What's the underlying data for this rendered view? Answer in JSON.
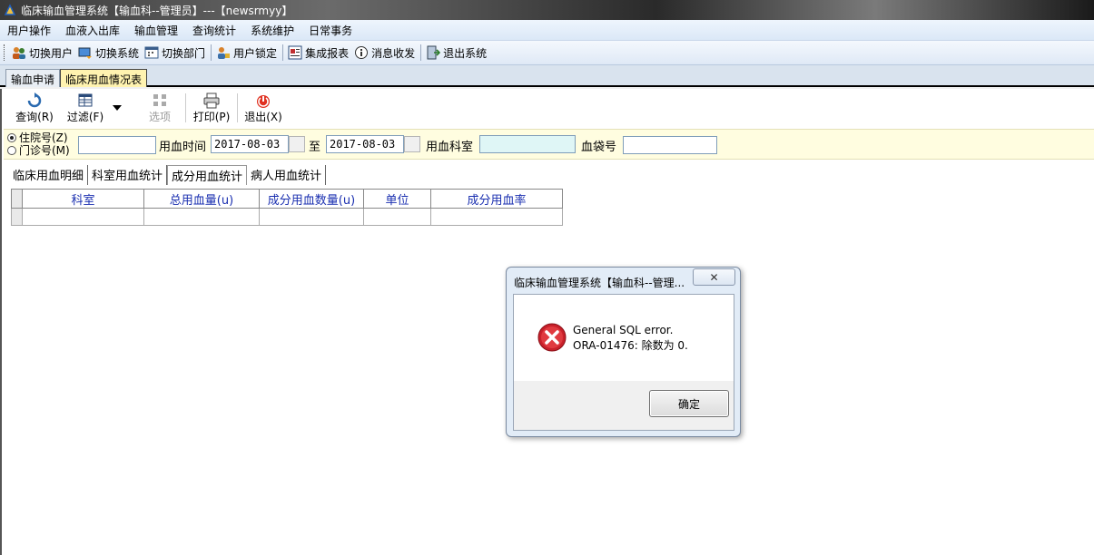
{
  "window": {
    "title": "临床输血管理系统【输血科--管理员】---【newsrmyy】"
  },
  "menu": [
    "用户操作",
    "血液入出库",
    "输血管理",
    "查询统计",
    "系统维护",
    "日常事务"
  ],
  "toolbar": {
    "switch_user": "切换用户",
    "switch_system": "切换系统",
    "switch_dept": "切换部门",
    "user_lock": "用户锁定",
    "integrated_report": "集成报表",
    "messages": "消息收发",
    "exit_system": "退出系统"
  },
  "page_tabs": {
    "tab1": "输血申请",
    "tab2": "临床用血情况表"
  },
  "actions": {
    "query": "查询(R)",
    "filter": "过滤(F)",
    "options": "选项",
    "print": "打印(P)",
    "exit": "退出(X)"
  },
  "filter": {
    "radio_inpatient": "住院号(Z)",
    "radio_outpatient": "门诊号(M)",
    "id_value": "",
    "time_label": "用血时间",
    "date_from": "2017-08-03",
    "to_label": "至",
    "date_to": "2017-08-03",
    "dept_label": "用血科室",
    "dept_value": "",
    "bag_label": "血袋号",
    "bag_value": ""
  },
  "sub_tabs": {
    "t1": "临床用血明细",
    "t2": "科室用血统计",
    "t3": "成分用血统计",
    "t4": "病人用血统计"
  },
  "grid": {
    "columns": [
      "科室",
      "总用血量(u)",
      "成分用血数量(u)",
      "单位",
      "成分用血率"
    ]
  },
  "dialog": {
    "title": "临床输血管理系统【输血科--管理...",
    "close": "✕",
    "line1": "General SQL error.",
    "line2": "ORA-01476: 除数为 0.",
    "ok": "确定"
  }
}
